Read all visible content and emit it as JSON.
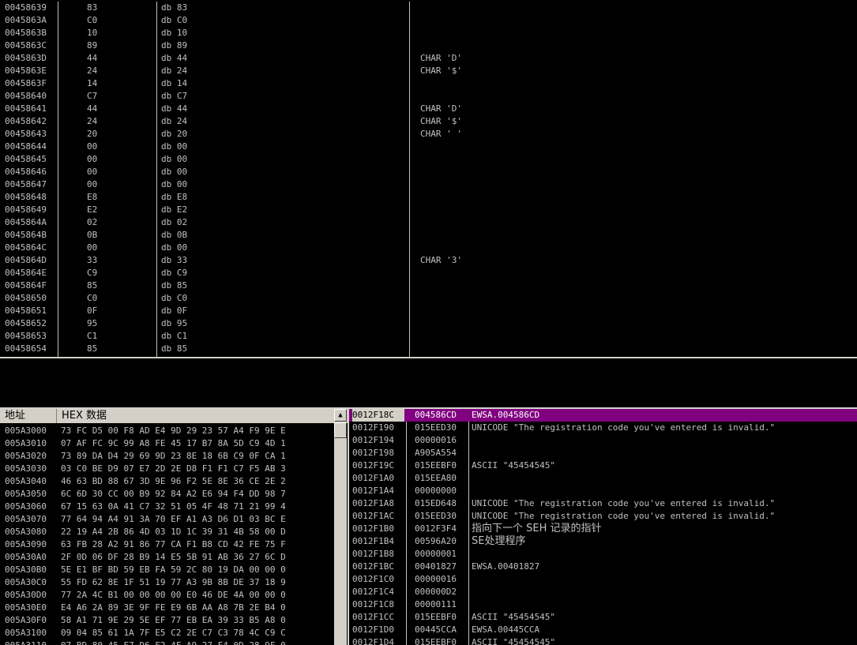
{
  "disasm": {
    "rows": [
      {
        "addr": "00458639",
        "hex": "83",
        "cmd": "db 83",
        "comment": ""
      },
      {
        "addr": "0045863A",
        "hex": "C0",
        "cmd": "db C0",
        "comment": ""
      },
      {
        "addr": "0045863B",
        "hex": "10",
        "cmd": "db 10",
        "comment": ""
      },
      {
        "addr": "0045863C",
        "hex": "89",
        "cmd": "db 89",
        "comment": ""
      },
      {
        "addr": "0045863D",
        "hex": "44",
        "cmd": "db 44",
        "comment": "CHAR 'D'"
      },
      {
        "addr": "0045863E",
        "hex": "24",
        "cmd": "db 24",
        "comment": "CHAR '$'"
      },
      {
        "addr": "0045863F",
        "hex": "14",
        "cmd": "db 14",
        "comment": ""
      },
      {
        "addr": "00458640",
        "hex": "C7",
        "cmd": "db C7",
        "comment": ""
      },
      {
        "addr": "00458641",
        "hex": "44",
        "cmd": "db 44",
        "comment": "CHAR 'D'"
      },
      {
        "addr": "00458642",
        "hex": "24",
        "cmd": "db 24",
        "comment": "CHAR '$'"
      },
      {
        "addr": "00458643",
        "hex": "20",
        "cmd": "db 20",
        "comment": "CHAR ' '"
      },
      {
        "addr": "00458644",
        "hex": "00",
        "cmd": "db 00",
        "comment": ""
      },
      {
        "addr": "00458645",
        "hex": "00",
        "cmd": "db 00",
        "comment": ""
      },
      {
        "addr": "00458646",
        "hex": "00",
        "cmd": "db 00",
        "comment": ""
      },
      {
        "addr": "00458647",
        "hex": "00",
        "cmd": "db 00",
        "comment": ""
      },
      {
        "addr": "00458648",
        "hex": "E8",
        "cmd": "db E8",
        "comment": ""
      },
      {
        "addr": "00458649",
        "hex": "E2",
        "cmd": "db E2",
        "comment": ""
      },
      {
        "addr": "0045864A",
        "hex": "02",
        "cmd": "db 02",
        "comment": ""
      },
      {
        "addr": "0045864B",
        "hex": "0B",
        "cmd": "db 0B",
        "comment": ""
      },
      {
        "addr": "0045864C",
        "hex": "00",
        "cmd": "db 00",
        "comment": ""
      },
      {
        "addr": "0045864D",
        "hex": "33",
        "cmd": "db 33",
        "comment": "CHAR '3'"
      },
      {
        "addr": "0045864E",
        "hex": "C9",
        "cmd": "db C9",
        "comment": ""
      },
      {
        "addr": "0045864F",
        "hex": "85",
        "cmd": "db 85",
        "comment": ""
      },
      {
        "addr": "00458650",
        "hex": "C0",
        "cmd": "db C0",
        "comment": ""
      },
      {
        "addr": "00458651",
        "hex": "0F",
        "cmd": "db 0F",
        "comment": ""
      },
      {
        "addr": "00458652",
        "hex": "95",
        "cmd": "db 95",
        "comment": ""
      },
      {
        "addr": "00458653",
        "hex": "C1",
        "cmd": "db C1",
        "comment": ""
      },
      {
        "addr": "00458654",
        "hex": "85",
        "cmd": "db 85",
        "comment": ""
      }
    ]
  },
  "dump": {
    "header_address": "地址",
    "header_hex": "HEX 数据",
    "rows": [
      {
        "addr": "005A3000",
        "hex": "73 FC D5 00 F8 AD E4 9D 29 23 57 A4 F9 9E E"
      },
      {
        "addr": "005A3010",
        "hex": "07 AF FC 9C 99 A8 FE 45 17 B7 8A 5D C9 4D 1"
      },
      {
        "addr": "005A3020",
        "hex": "73 89 DA D4 29 69 9D 23 8E 18 6B C9 0F CA 1"
      },
      {
        "addr": "005A3030",
        "hex": "03 C0 BE D9 07 E7 2D 2E D8 F1 F1 C7 F5 AB 3"
      },
      {
        "addr": "005A3040",
        "hex": "46 63 BD 88 67 3D 9E 96 F2 5E 8E 36 CE 2E 2"
      },
      {
        "addr": "005A3050",
        "hex": "6C 6D 30 CC 00 B9 92 84 A2 E6 94 F4 DD 98 7"
      },
      {
        "addr": "005A3060",
        "hex": "67 15 63 0A 41 C7 32 51 05 4F 48 71 21 99 4"
      },
      {
        "addr": "005A3070",
        "hex": "77 64 94 A4 91 3A 70 EF A1 A3 D6 D1 03 BC E"
      },
      {
        "addr": "005A3080",
        "hex": "22 19 A4 2B 86 4D 03 1D 1C 39 31 4B 58 00 D"
      },
      {
        "addr": "005A3090",
        "hex": "63 FB 28 A2 91 86 77 CA F1 B8 CD 42 FE 75 F"
      },
      {
        "addr": "005A30A0",
        "hex": "2F 0D 06 DF 28 B9 14 E5 5B 91 AB 36 27 6C D"
      },
      {
        "addr": "005A30B0",
        "hex": "5E E1 BF BD 59 EB FA 59 2C 80 19 DA 00 00 0"
      },
      {
        "addr": "005A30C0",
        "hex": "55 FD 62 8E 1F 51 19 77 A3 9B 8B DE 37 18 9"
      },
      {
        "addr": "005A30D0",
        "hex": "77 2A 4C B1 00 00 00 00 E0 46 DE 4A 00 00 0"
      },
      {
        "addr": "005A30E0",
        "hex": "E4 A6 2A 89 3E 9F FE E9 6B AA A8 7B 2E B4 0"
      },
      {
        "addr": "005A30F0",
        "hex": "58 A1 71 9E 29 5E EF 77 EB EA 39 33 B5 A8 0"
      },
      {
        "addr": "005A3100",
        "hex": "09 04 85 61 1A 7F E5 C2 2E C7 C3 78 4C C9 C"
      },
      {
        "addr": "005A3110",
        "hex": "07 BD 80 45 E7 D6 F2 4F A9 27 F4 0D 28 9F 0"
      }
    ]
  },
  "stack": {
    "rows": [
      {
        "addr": "0012F18C",
        "val": "004586CD",
        "comment": "EWSA.004586CD"
      },
      {
        "addr": "0012F190",
        "val": "015EED30",
        "comment": "UNICODE \"The registration code you've entered is invalid.\""
      },
      {
        "addr": "0012F194",
        "val": "00000016",
        "comment": ""
      },
      {
        "addr": "0012F198",
        "val": "A905A554",
        "comment": ""
      },
      {
        "addr": "0012F19C",
        "val": "015EEBF0",
        "comment": "ASCII \"45454545\""
      },
      {
        "addr": "0012F1A0",
        "val": "015EEA80",
        "comment": ""
      },
      {
        "addr": "0012F1A4",
        "val": "00000000",
        "comment": ""
      },
      {
        "addr": "0012F1A8",
        "val": "015ED648",
        "comment": "UNICODE \"The registration code you've entered is invalid.\""
      },
      {
        "addr": "0012F1AC",
        "val": "015EED30",
        "comment": "UNICODE \"The registration code you've entered is invalid.\""
      },
      {
        "addr": "0012F1B0",
        "val": "0012F3F4",
        "comment": "指向下一个 SEH 记录的指针"
      },
      {
        "addr": "0012F1B4",
        "val": "00596A20",
        "comment": "SE处理程序"
      },
      {
        "addr": "0012F1B8",
        "val": "00000001",
        "comment": ""
      },
      {
        "addr": "0012F1BC",
        "val": "00401827",
        "comment": "EWSA.00401827"
      },
      {
        "addr": "0012F1C0",
        "val": "00000016",
        "comment": ""
      },
      {
        "addr": "0012F1C4",
        "val": "000000D2",
        "comment": ""
      },
      {
        "addr": "0012F1C8",
        "val": "00000111",
        "comment": ""
      },
      {
        "addr": "0012F1CC",
        "val": "015EEBF0",
        "comment": "ASCII \"45454545\""
      },
      {
        "addr": "0012F1D0",
        "val": "00445CCA",
        "comment": "EWSA.00445CCA"
      },
      {
        "addr": "0012F1D4",
        "val": "015EEBF0",
        "comment": "ASCII \"45454545\""
      }
    ]
  },
  "colors": {
    "background": "#000000",
    "text": "#c0c0c0",
    "selection": "#800080",
    "chrome": "#d4d0c8"
  }
}
